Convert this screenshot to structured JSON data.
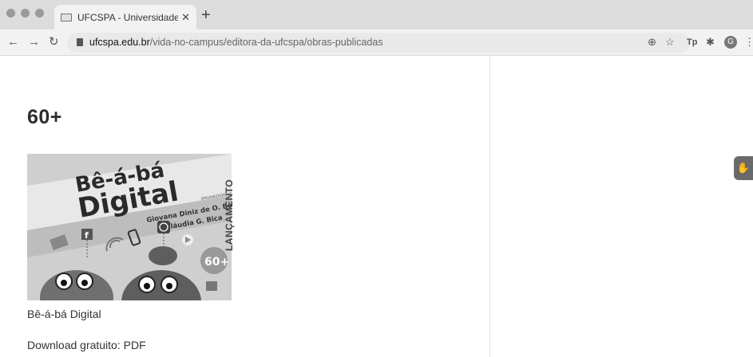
{
  "browser": {
    "tab_title": "UFCSPA - Universidade Federa",
    "url_domain": "ufcspa.edu.br",
    "url_path": "/vida-no-campus/editora-da-ufcspa/obras-publicadas",
    "avatar_letter": "G",
    "tp_label": "Tp"
  },
  "page": {
    "heading": "60+",
    "book": {
      "cover_title_line1": "Bê-á-bá",
      "cover_title_line2": "Digital",
      "cover_org_label": "ORGANIZADORAS",
      "cover_authors_line1": "Giovana Diniz de O. Bonetti",
      "cover_authors_line2": "Cláudia G. Bica",
      "cover_badge": "60+",
      "side_label": "LANÇAMENTO",
      "title": "Bê-á-bá Digital",
      "download_prefix": "Download gratuito: ",
      "download_link": "PDF"
    }
  }
}
